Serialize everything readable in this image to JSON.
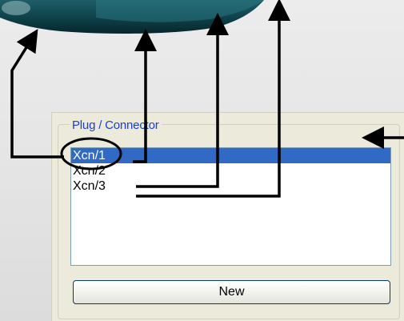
{
  "connector_group": {
    "legend": "Plug / Connector",
    "items": [
      {
        "label": "Xcn/1",
        "selected": true
      },
      {
        "label": "Xcn/2",
        "selected": false
      },
      {
        "label": "Xcn/3",
        "selected": false
      }
    ],
    "new_button_label": "New"
  },
  "colors": {
    "selection": "#316ac5",
    "legend_text": "#1c3fd0",
    "panel_background": "#ebeadb",
    "annotation": "#000000"
  },
  "icons": [
    "connector-plug-image",
    "arrow-up-icon",
    "arrow-left-icon",
    "highlight-circle-icon"
  ]
}
